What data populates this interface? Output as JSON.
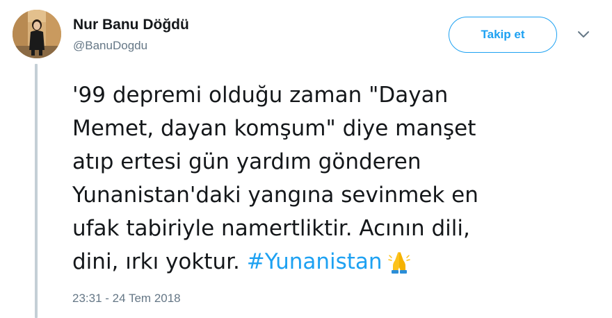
{
  "author": {
    "name": "Nur Banu Döğdü",
    "handle": "@BanuDogdu",
    "avatar": "avatar-photo"
  },
  "actions": {
    "follow_label": "Takip et",
    "menu_icon": "chevron-down-icon"
  },
  "tweet": {
    "lines": [
      "'99 depremi olduğu zaman \"Dayan",
      "Memet, dayan komşum\" diye manşet",
      "atıp ertesi gün yardım gönderen",
      "Yunanistan'daki yangına sevinmek en",
      "ufak tabiriyle namertliktir. Acının dili,",
      "dini, ırkı yoktur. "
    ],
    "hashtag": "#Yunanistan",
    "emoji": "folded-hands-emoji"
  },
  "timestamp": "23:31 - 24 Tem 2018",
  "colors": {
    "accent": "#1da1f2",
    "text": "#14171a",
    "secondary": "#657786",
    "thread_line": "#c4cfd6"
  }
}
